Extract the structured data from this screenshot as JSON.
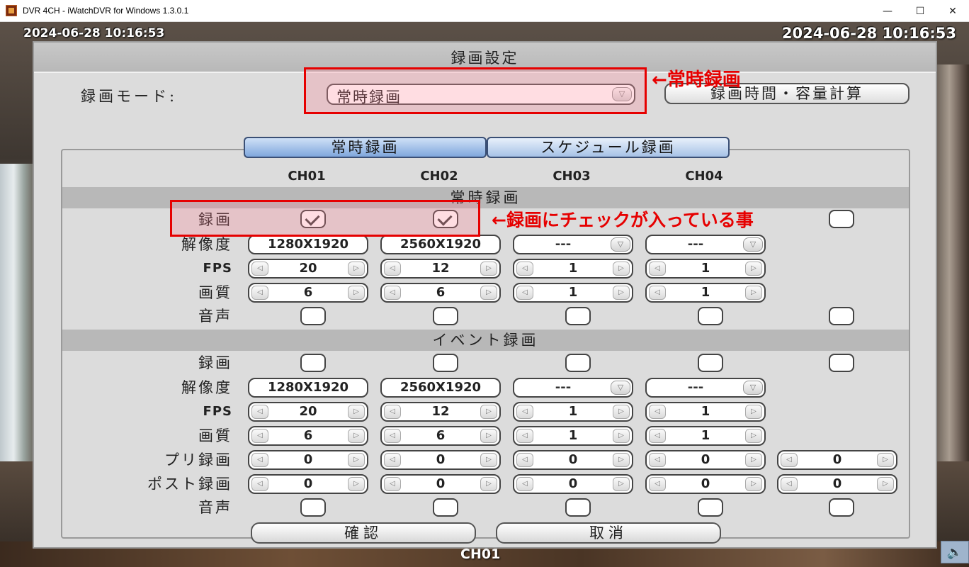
{
  "window": {
    "title": "DVR 4CH - iWatchDVR for Windows 1.3.0.1",
    "controls": {
      "minimize": "—",
      "maximize": "☐",
      "close": "✕"
    }
  },
  "video": {
    "timestamp_left": "2024-06-28 10:16:53",
    "timestamp_right": "2024-06-28 10:16:53",
    "channel": "CH01"
  },
  "dialog": {
    "title": "録画設定",
    "mode_label": "録画モード:",
    "mode_value": "常時録画",
    "calc_button": "録画時間・容量計算",
    "tabs": {
      "active": "常時録画",
      "inactive": "スケジュール録画"
    },
    "channels": [
      "CH01",
      "CH02",
      "CH03",
      "CH04"
    ],
    "continuous": {
      "section": "常時録画",
      "labels": {
        "record": "録画",
        "resolution": "解像度",
        "fps": "FPS",
        "quality": "画質",
        "audio": "音声"
      },
      "resolution": [
        "1280X1920",
        "2560X1920",
        "---",
        "---"
      ],
      "fps": [
        "20",
        "12",
        "1",
        "1"
      ],
      "quality": [
        "6",
        "6",
        "1",
        "1"
      ]
    },
    "event": {
      "section": "イベント録画",
      "labels": {
        "record": "録画",
        "resolution": "解像度",
        "fps": "FPS",
        "quality": "画質",
        "pre": "プリ録画",
        "post": "ポスト録画",
        "audio": "音声"
      },
      "resolution": [
        "1280X1920",
        "2560X1920",
        "---",
        "---"
      ],
      "fps": [
        "20",
        "12",
        "1",
        "1"
      ],
      "quality": [
        "6",
        "6",
        "1",
        "1"
      ],
      "pre": [
        "0",
        "0",
        "0",
        "0",
        "0"
      ],
      "post": [
        "0",
        "0",
        "0",
        "0",
        "0"
      ]
    },
    "confirm": "確認",
    "cancel": "取消"
  },
  "annotations": {
    "mode_note": "←常時録画",
    "record_note": "←録画にチェックが入っている事",
    "color": "#e60000"
  },
  "colors": {
    "tab_active": "#7fa7dc",
    "dialog_bg": "#dcdcdc",
    "section_bar": "#b8b8b8"
  }
}
